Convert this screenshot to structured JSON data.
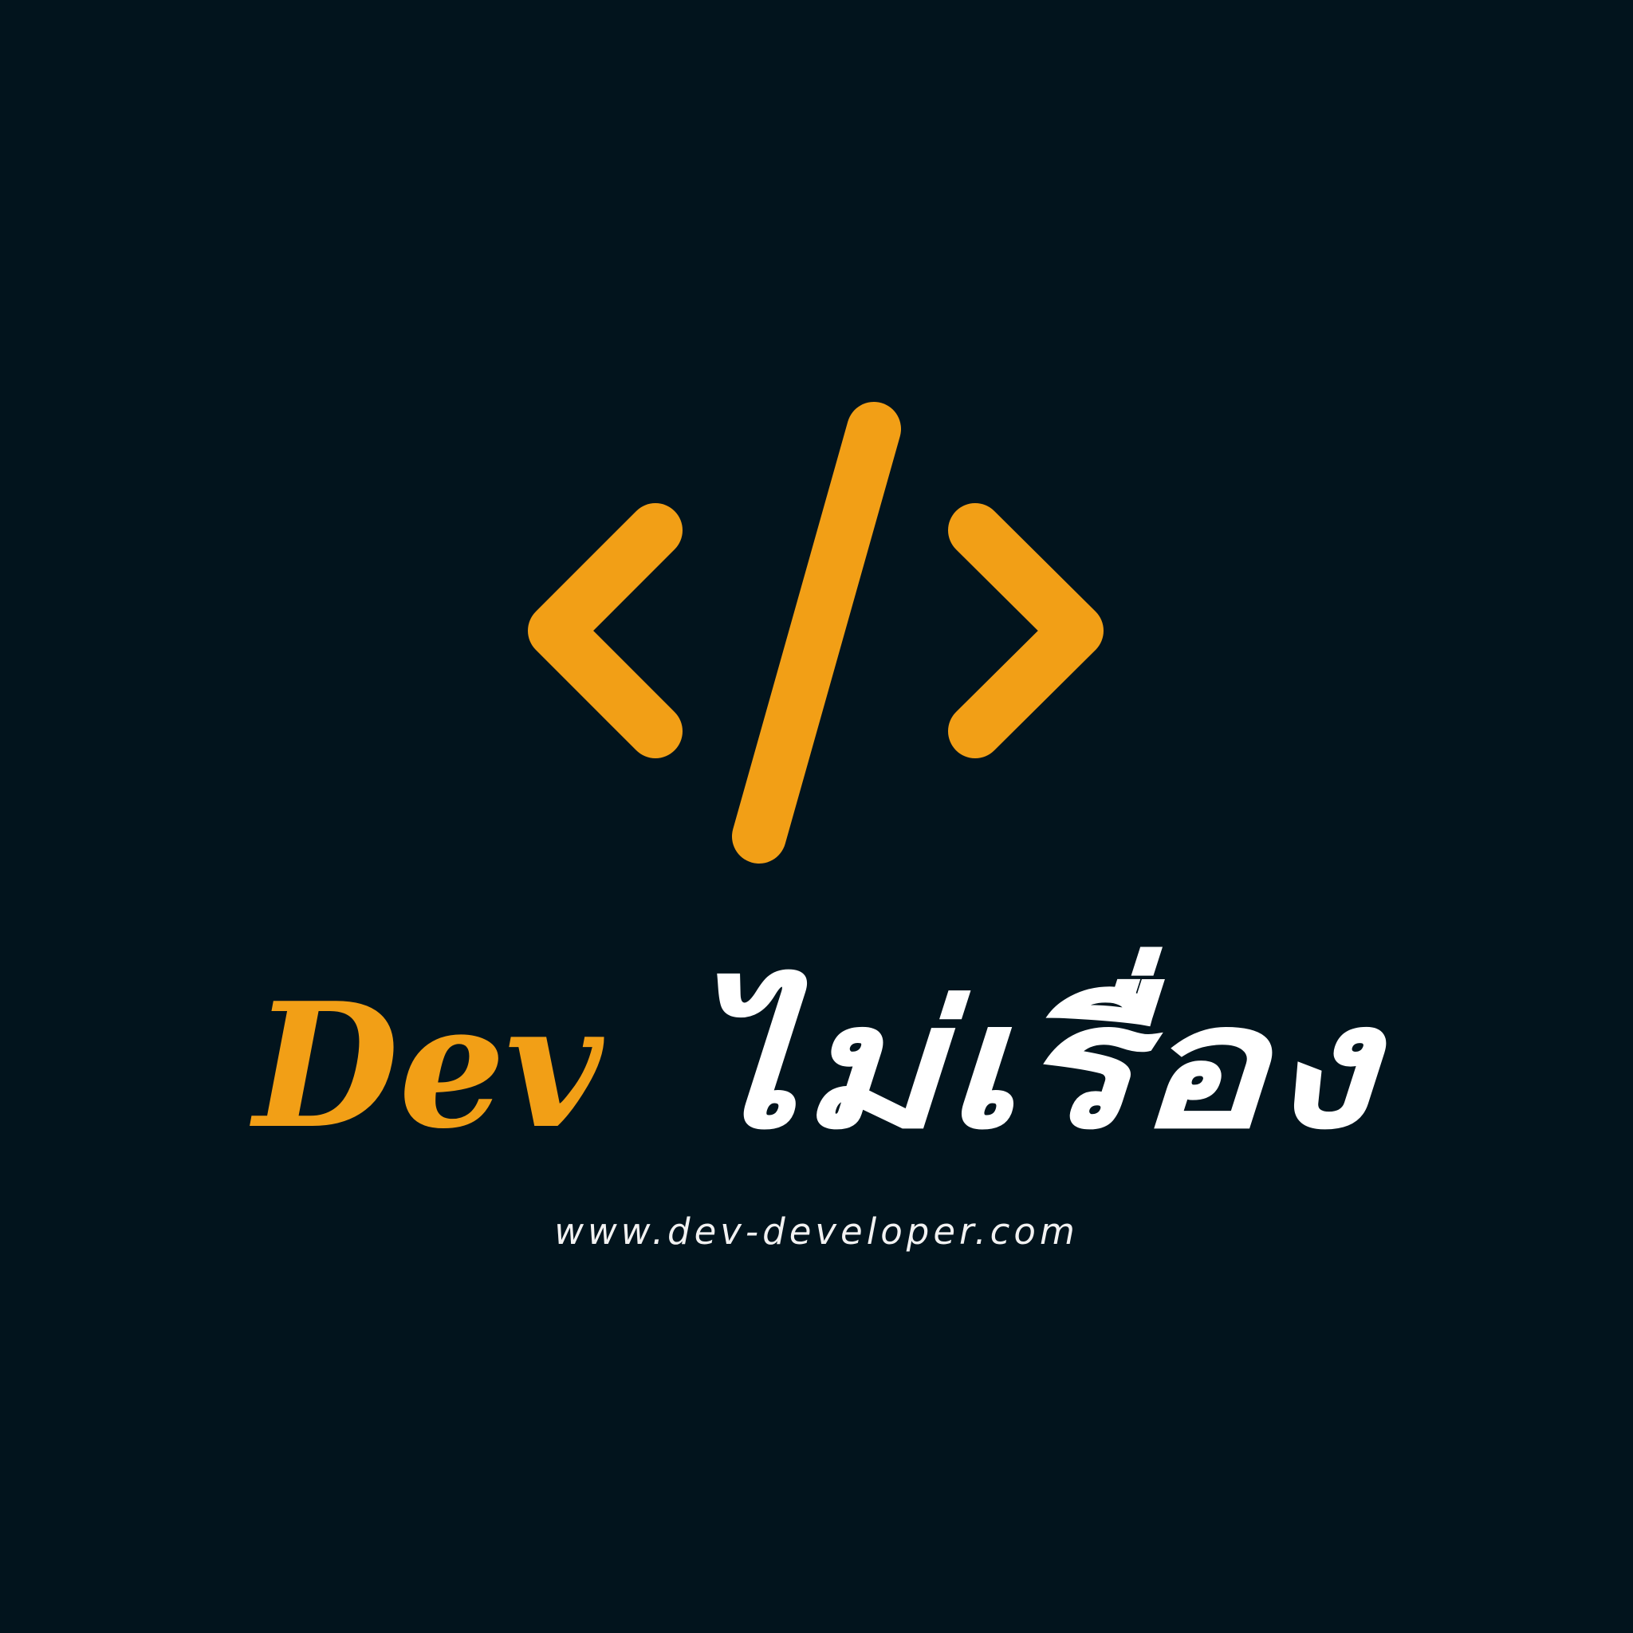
{
  "logo": {
    "brand_part1": "Dev",
    "brand_part2": "ไม่เรื่อง",
    "icon": "code-brackets-icon",
    "accent_color": "#f29f16",
    "secondary_color": "#ffffff",
    "background_color": "#02141d"
  },
  "footer": {
    "website": "www.dev-developer.com"
  }
}
